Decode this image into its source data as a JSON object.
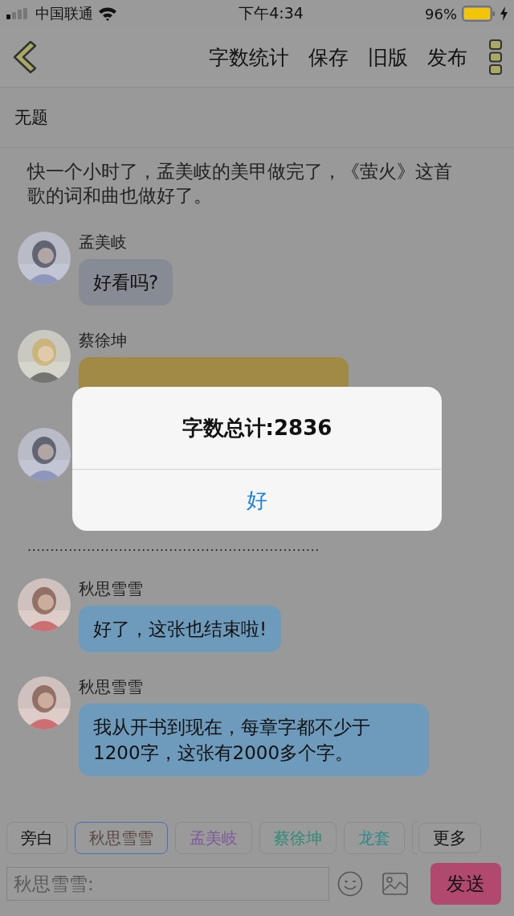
{
  "status_bar": {
    "carrier": "中国联通",
    "time": "下午4:34",
    "battery": "96%"
  },
  "nav": {
    "actions": [
      "字数统计",
      "保存",
      "旧版",
      "发布"
    ]
  },
  "title": "无题",
  "narration": "快一个小时了，孟美岐的美甲做完了，《萤火》这首歌的词和曲也做好了。",
  "messages": [
    {
      "kind": "message",
      "name": "孟美岐",
      "text": "好看吗?",
      "color": "#878b93"
    },
    {
      "kind": "covered",
      "name": "蔡徐坤",
      "color": "#a08a45"
    },
    {
      "kind": "avatar"
    },
    {
      "kind": "divider",
      "text": "................................................................"
    },
    {
      "kind": "message",
      "name": "秋思雪雪",
      "text": "好了，这张也结束啦!",
      "color": "#6e9bbb"
    },
    {
      "kind": "message",
      "name": "秋思雪雪",
      "text": "我从开书到现在，每章字都不少于1200字，这张有2000多个字。",
      "color": "#6e9bbb"
    }
  ],
  "roles": [
    {
      "label": "旁白",
      "selected": false,
      "color": "#111111"
    },
    {
      "label": "秋思雪雪",
      "selected": true,
      "color": "#5a4a44"
    },
    {
      "label": "孟美岐",
      "selected": false,
      "color": "#7e5a9a"
    },
    {
      "label": "蔡徐坤",
      "selected": false,
      "color": "#2f8a78"
    },
    {
      "label": "龙套",
      "selected": false,
      "color": "#2f8a8a"
    }
  ],
  "more_button": "更多",
  "input": {
    "placeholder": "秋思雪雪:"
  },
  "send_button": "发送",
  "alert": {
    "title": "字数总计:2836",
    "button": "好"
  }
}
